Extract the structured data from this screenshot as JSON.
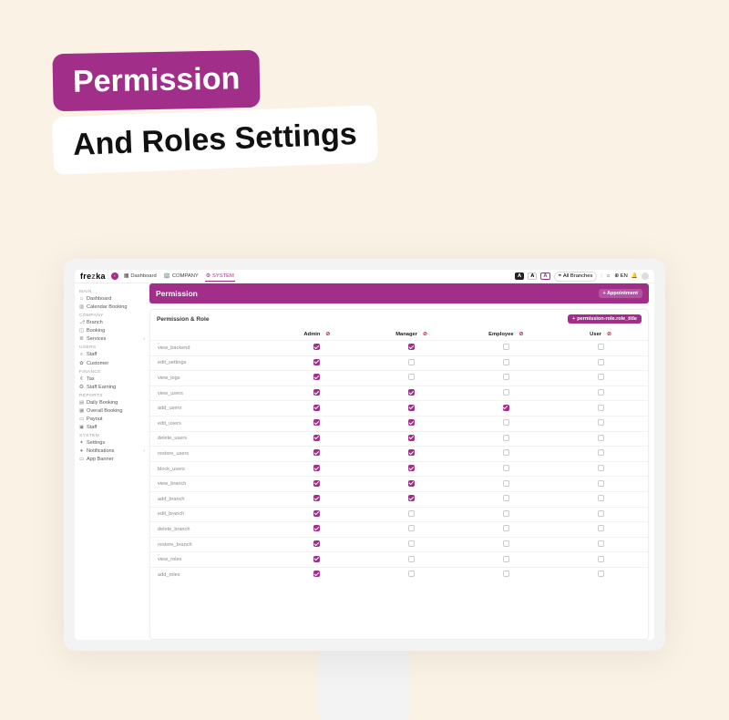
{
  "promo": {
    "line1": "Permission",
    "line2": "And Roles Settings"
  },
  "brand": "frezka",
  "tabs": [
    {
      "icon": "▦",
      "label": "Dashboard"
    },
    {
      "icon": "🏢",
      "label": "COMPANY"
    },
    {
      "icon": "⚙",
      "label": "SYSTEM"
    }
  ],
  "topright": {
    "branches": "All Branches",
    "lang": "EN"
  },
  "sidebar": [
    {
      "group": "MAIN"
    },
    {
      "icon": "⌂",
      "label": "Dashboard"
    },
    {
      "icon": "▥",
      "label": "Calendar Booking"
    },
    {
      "group": "COMPANY"
    },
    {
      "icon": "⎇",
      "label": "Branch"
    },
    {
      "icon": "◫",
      "label": "Booking"
    },
    {
      "icon": "≣",
      "label": "Services",
      "chev": true
    },
    {
      "group": "USERS"
    },
    {
      "icon": "⌕",
      "label": "Staff"
    },
    {
      "icon": "✿",
      "label": "Customer"
    },
    {
      "group": "FINANCE"
    },
    {
      "icon": "¢",
      "label": "Tax"
    },
    {
      "icon": "✪",
      "label": "Staff Earning"
    },
    {
      "group": "REPORTS"
    },
    {
      "icon": "▤",
      "label": "Daily Booking"
    },
    {
      "icon": "▦",
      "label": "Overall Booking"
    },
    {
      "icon": "▭",
      "label": "Payout"
    },
    {
      "icon": "▣",
      "label": "Staff"
    },
    {
      "group": "SYSTEM"
    },
    {
      "icon": "✦",
      "label": "Settings"
    },
    {
      "icon": "●",
      "label": "Notifications",
      "chev": true
    },
    {
      "icon": "▭",
      "label": "App Banner"
    }
  ],
  "page": {
    "banner_title": "Permission",
    "appointment_btn": "+ Appointment",
    "card_title": "Permission & Role",
    "add_btn": "permission-role.role_title"
  },
  "roles": [
    "Admin",
    "Manager",
    "Employee",
    "User"
  ],
  "permissions": [
    {
      "name": "view_backend",
      "checks": [
        1,
        1,
        0,
        0
      ]
    },
    {
      "name": "edit_settings",
      "checks": [
        1,
        0,
        0,
        0
      ]
    },
    {
      "name": "view_logs",
      "checks": [
        1,
        0,
        0,
        0
      ]
    },
    {
      "name": "view_users",
      "checks": [
        1,
        1,
        0,
        0
      ]
    },
    {
      "name": "add_users",
      "checks": [
        1,
        1,
        1,
        0
      ]
    },
    {
      "name": "edit_users",
      "checks": [
        1,
        1,
        0,
        0
      ]
    },
    {
      "name": "delete_users",
      "checks": [
        1,
        1,
        0,
        0
      ]
    },
    {
      "name": "restore_users",
      "checks": [
        1,
        1,
        0,
        0
      ]
    },
    {
      "name": "block_users",
      "checks": [
        1,
        1,
        0,
        0
      ]
    },
    {
      "name": "view_branch",
      "checks": [
        1,
        1,
        0,
        0
      ]
    },
    {
      "name": "add_branch",
      "checks": [
        1,
        1,
        0,
        0
      ]
    },
    {
      "name": "edit_branch",
      "checks": [
        1,
        0,
        0,
        0
      ]
    },
    {
      "name": "delete_branch",
      "checks": [
        1,
        0,
        0,
        0
      ]
    },
    {
      "name": "restore_branch",
      "checks": [
        1,
        0,
        0,
        0
      ]
    },
    {
      "name": "view_roles",
      "checks": [
        1,
        0,
        0,
        0
      ]
    },
    {
      "name": "add_roles",
      "checks": [
        1,
        0,
        0,
        0
      ]
    }
  ]
}
